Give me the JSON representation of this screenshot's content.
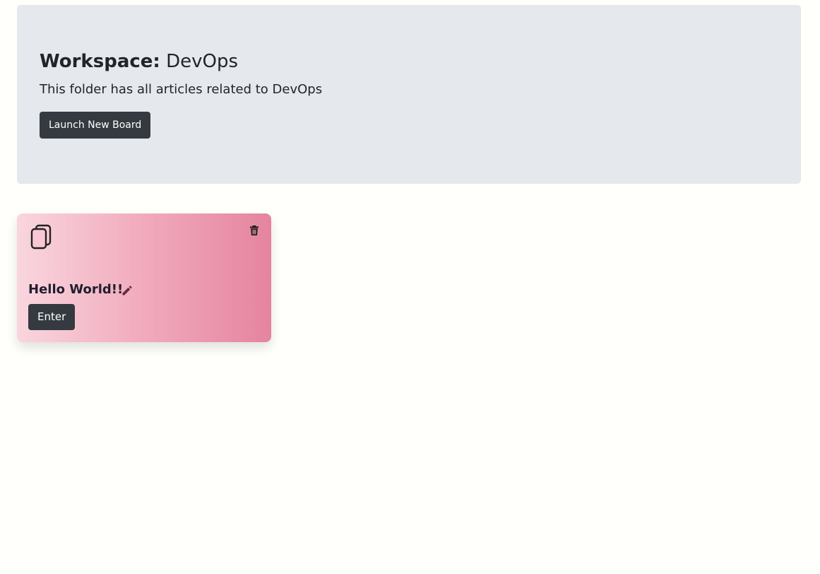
{
  "workspace": {
    "label": "Workspace:",
    "name": "DevOps",
    "description": "This folder has all articles related to DevOps",
    "launch_button_label": "Launch New Board"
  },
  "boards": [
    {
      "title": "Hello World!!",
      "enter_label": "Enter",
      "icons": {
        "board": "copy-icon",
        "delete": "trash-icon",
        "edit": "pencil-icon"
      }
    }
  ],
  "colors": {
    "page_background": "#fffffb",
    "header_background": "#e5e8ec",
    "button_dark": "#343a40",
    "card_gradient_start": "#f9d6de",
    "card_gradient_end": "#e5849e",
    "edit_icon": "#6a2a4a"
  }
}
